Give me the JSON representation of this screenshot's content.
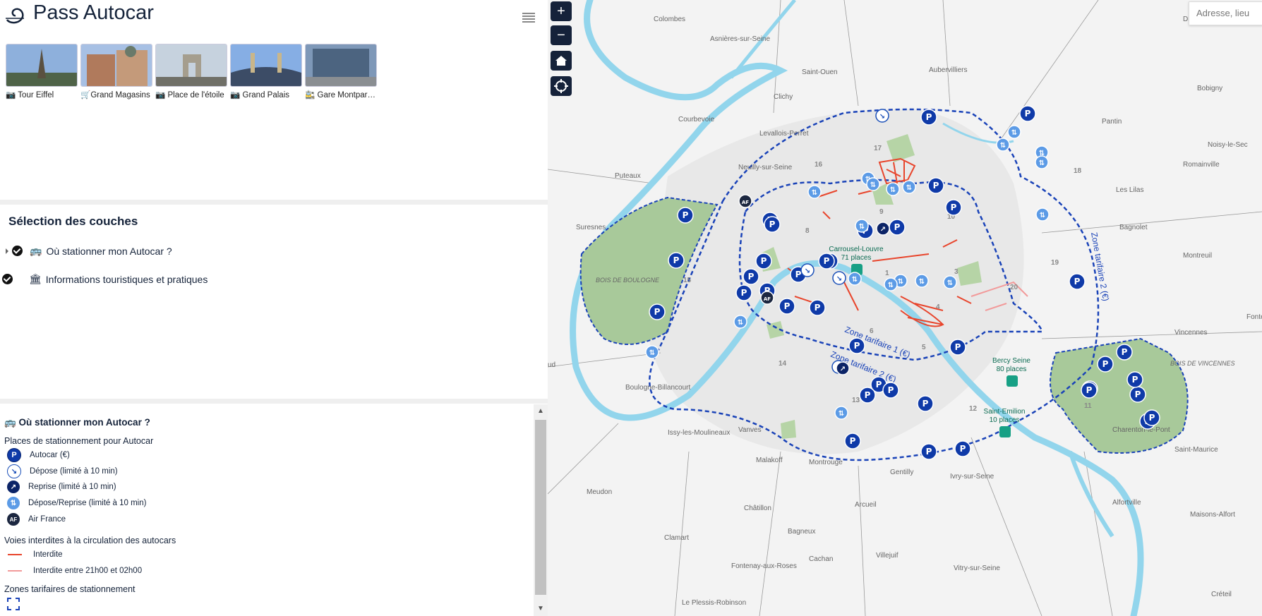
{
  "app": {
    "title": "Pass Autocar"
  },
  "thumbnails": [
    {
      "label": "📷 Tour Eiffel",
      "colors": [
        "#7aa0d0",
        "#4b5e48"
      ]
    },
    {
      "label": "🛒Grand Magasins",
      "colors": [
        "#9cb8de",
        "#a06a52"
      ]
    },
    {
      "label": "📷 Place de l'étoile",
      "colors": [
        "#b8c8d8",
        "#8a8a80"
      ]
    },
    {
      "label": "📷 Grand Palais",
      "colors": [
        "#7fa6dc",
        "#3f4f6a"
      ]
    },
    {
      "label": "🚉 Gare Montparnasse",
      "colors": [
        "#6f8fb8",
        "#4a5a6a"
      ]
    }
  ],
  "layers": {
    "title": "Sélection des couches",
    "items": [
      {
        "label": "Où stationner mon Autocar ?",
        "icon": "🚌",
        "checked": true
      },
      {
        "label": "Informations touristiques et pratiques",
        "icon": "🏛",
        "checked": true
      }
    ]
  },
  "legend": {
    "title": "🚌 Où stationner mon Autocar ?",
    "parking_section": "Places de stationnement pour Autocar",
    "parking_items": [
      {
        "label": "Autocar (€)",
        "icon": "p",
        "glyph": "P"
      },
      {
        "label": "Dépose (limité à 10 min)",
        "icon": "dep",
        "glyph": "↘"
      },
      {
        "label": "Reprise (limité à 10 min)",
        "icon": "rep",
        "glyph": "↗"
      },
      {
        "label": "Dépose/Reprise (limité à 10 min)",
        "icon": "dr",
        "glyph": "⇅"
      },
      {
        "label": "Air France",
        "icon": "af",
        "glyph": "AF"
      }
    ],
    "roads_section": "Voies interdites à la circulation des autocars",
    "road_items": [
      {
        "label": "Interdite",
        "color": "#e8452c"
      },
      {
        "label": "Interdite entre 21h00 et 02h00",
        "color": "#f29a9a"
      }
    ],
    "zones_section": "Zones tarifaires de stationnement"
  },
  "map": {
    "controls": {
      "zoom_in": "+",
      "zoom_out": "−",
      "home": "⌂",
      "locate": "◎"
    },
    "search_placeholder": "Adresse, lieu",
    "places": [
      {
        "name": "Colombes"
      },
      {
        "name": "Asnières-sur-Seine"
      },
      {
        "name": "Saint-Ouen"
      },
      {
        "name": "Aubervilliers"
      },
      {
        "name": "Drancy"
      },
      {
        "name": "Clichy"
      },
      {
        "name": "Bobigny"
      },
      {
        "name": "Courbevoie"
      },
      {
        "name": "Levallois-Perret"
      },
      {
        "name": "Pantin"
      },
      {
        "name": "Noisy-le-Sec"
      },
      {
        "name": "Puteaux"
      },
      {
        "name": "Neuilly-sur-Seine"
      },
      {
        "name": "Romainville"
      },
      {
        "name": "Les Lilas"
      },
      {
        "name": "Suresnes"
      },
      {
        "name": "Bagnolet"
      },
      {
        "name": "Montreuil"
      },
      {
        "name": "BOIS DE BOULOGNE"
      },
      {
        "name": "Fontenay-sous"
      },
      {
        "name": "Vincennes"
      },
      {
        "name": "Boulogne-Billancourt"
      },
      {
        "name": "Issy-les-Moulineaux"
      },
      {
        "name": "Charenton-le-Pont"
      },
      {
        "name": "Saint-Maurice"
      },
      {
        "name": "Vanves"
      },
      {
        "name": "Malakoff"
      },
      {
        "name": "Montrouge"
      },
      {
        "name": "Gentilly"
      },
      {
        "name": "Ivry-sur-Seine"
      },
      {
        "name": "Meudon"
      },
      {
        "name": "Châtillon"
      },
      {
        "name": "Arcueil"
      },
      {
        "name": "Maisons-Alfort"
      },
      {
        "name": "Alfortville"
      },
      {
        "name": "Clamart"
      },
      {
        "name": "Bagneux"
      },
      {
        "name": "Villejuif"
      },
      {
        "name": "Vitry-sur-Seine"
      },
      {
        "name": "Créteil"
      },
      {
        "name": "Cachan"
      },
      {
        "name": "Fontenay-aux-Roses"
      },
      {
        "name": "Le Plessis-Robinson"
      },
      {
        "name": "BOIS DE VINCENNES"
      },
      {
        "name": "ud"
      }
    ],
    "arrondissements": [
      "1",
      "3",
      "4",
      "5",
      "6",
      "8",
      "10",
      "11",
      "12",
      "13",
      "14",
      "15",
      "16",
      "17",
      "18",
      "19",
      "20",
      "9"
    ],
    "stations": [
      {
        "name": "Carrousel-Louvre",
        "places": "71 places"
      },
      {
        "name": "Bercy Seine",
        "places": "80 places"
      },
      {
        "name": "Saint-Emilion",
        "places": "10 places"
      }
    ],
    "zone_labels": [
      "Zone tarifaire 1 (€)",
      "Zone tarifaire 2 (€)",
      "Zone tarifaire 2 (€)"
    ]
  }
}
